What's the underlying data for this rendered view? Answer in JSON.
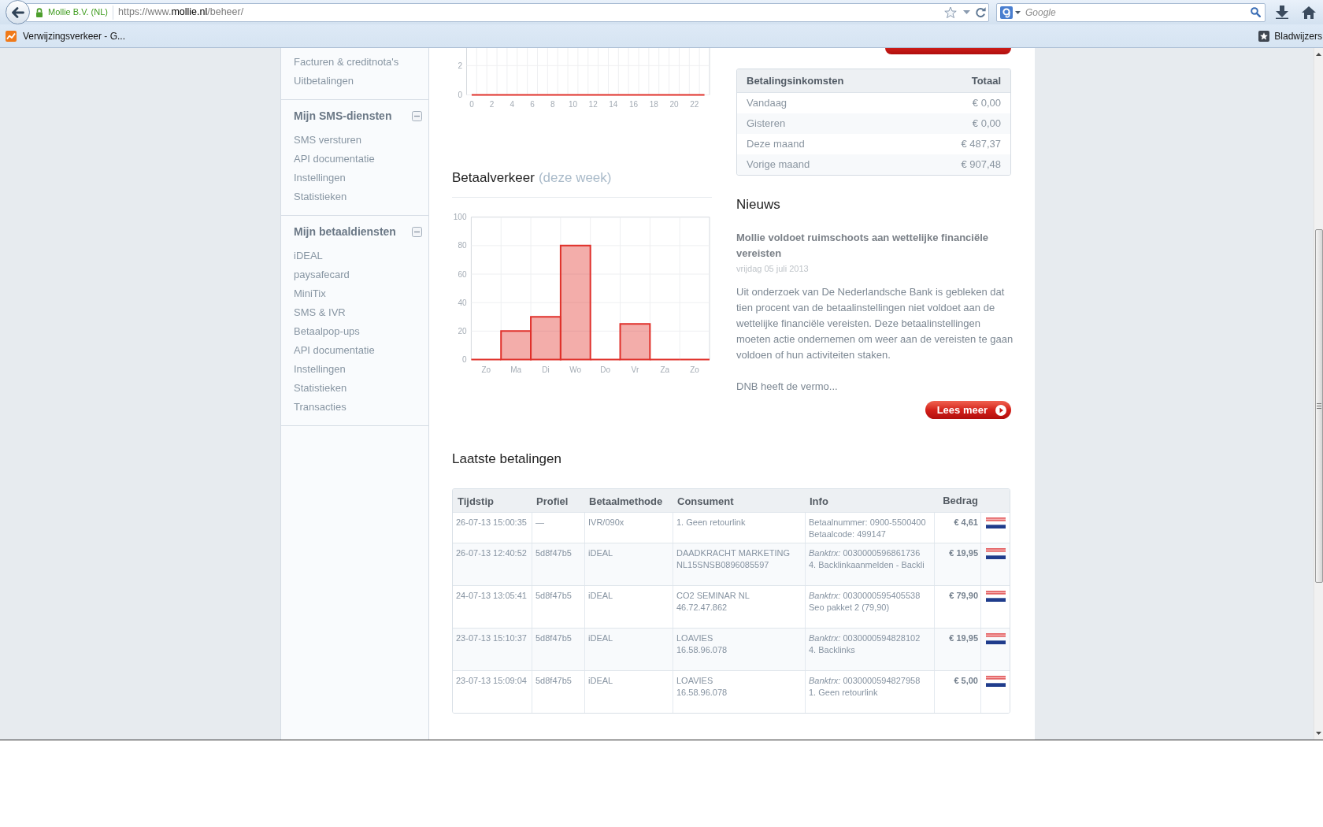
{
  "browser": {
    "site_identity": "Mollie B.V. (NL)",
    "url_parts": [
      {
        "text": "https://www.",
        "emphasis": false
      },
      {
        "text": "mollie.nl",
        "emphasis": true
      },
      {
        "text": "/beheer/",
        "emphasis": false
      }
    ],
    "search": {
      "placeholder": "Google"
    }
  },
  "bookmarks_bar": {
    "bookmarks": [
      {
        "label": "Verwijzingsverkeer - G..."
      }
    ],
    "menu_label": "Bladwijzers"
  },
  "sidebar": {
    "sections": [
      {
        "items": [
          {
            "label": "Facturen & creditnota's"
          },
          {
            "label": "Uitbetalingen"
          }
        ]
      },
      {
        "title": "Mijn SMS-diensten",
        "expanded": true,
        "items": [
          {
            "label": "SMS versturen"
          },
          {
            "label": "API documentatie"
          },
          {
            "label": "Instellingen"
          },
          {
            "label": "Statistieken"
          }
        ]
      },
      {
        "title": "Mijn betaaldiensten",
        "expanded": true,
        "items": [
          {
            "label": "iDEAL"
          },
          {
            "label": "paysafecard"
          },
          {
            "label": "MiniTix"
          },
          {
            "label": "SMS & IVR"
          },
          {
            "label": "Betaalpop-ups"
          },
          {
            "label": "API documentatie"
          },
          {
            "label": "Instellingen"
          },
          {
            "label": "Statistieken"
          },
          {
            "label": "Transacties"
          }
        ]
      }
    ]
  },
  "hourly_chart": {
    "chart_data": {
      "type": "line",
      "x": [
        0,
        1,
        2,
        3,
        4,
        5,
        6,
        7,
        8,
        9,
        10,
        11,
        12,
        13,
        14,
        15,
        16,
        17,
        18,
        19,
        20,
        21,
        22,
        23
      ],
      "xlim": [
        -0.5,
        23.5
      ],
      "ylim": [
        0,
        3.2
      ],
      "xticks": [
        0,
        2,
        4,
        6,
        8,
        10,
        12,
        14,
        16,
        18,
        20,
        22
      ],
      "yticks": [
        0,
        2
      ],
      "grid": true,
      "series": [
        {
          "color": "#e0312b",
          "values": [
            0,
            0,
            0,
            0,
            0,
            0,
            0,
            0,
            0,
            0,
            0,
            0,
            0,
            0,
            0,
            0,
            0,
            0,
            0,
            0,
            0,
            0,
            0,
            0
          ]
        }
      ]
    }
  },
  "weekly_chart": {
    "heading": "Betaalverkeer",
    "subheading": "(deze week)",
    "chart_data": {
      "type": "bar",
      "categories": [
        "Zo",
        "Ma",
        "Di",
        "Wo",
        "Do",
        "Vr",
        "Za",
        "Zo"
      ],
      "ylim": [
        0,
        100
      ],
      "yticks": [
        0,
        20,
        40,
        60,
        80,
        100
      ],
      "grid": true,
      "series": [
        {
          "color": "#e0312b",
          "values": [
            0,
            20,
            30,
            80,
            0,
            25,
            0,
            0
          ]
        }
      ]
    }
  },
  "income_table": {
    "columns": [
      "Betalingsinkomsten",
      "Totaal"
    ],
    "rows": [
      {
        "period": "Vandaag",
        "total": "€ 0,00"
      },
      {
        "period": "Gisteren",
        "total": "€ 0,00"
      },
      {
        "period": "Deze maand",
        "total": "€ 487,37"
      },
      {
        "period": "Vorige maand",
        "total": "€ 907,48"
      }
    ]
  },
  "news": {
    "heading": "Nieuws",
    "title": "Mollie voldoet ruimschoots aan wettelijke financiële vereisten",
    "date": "vrijdag 05 juli 2013",
    "paragraphs": [
      "Uit onderzoek van De Nederlandsche Bank is gebleken dat tien procent van de betaalinstellingen niet voldoet aan de wettelijke financiële vereisten. Deze betaalinstellingen moeten actie ondernemen om weer aan de vereisten te gaan voldoen of hun activiteiten staken.",
      "DNB heeft de vermo..."
    ],
    "button": "Lees meer"
  },
  "payments": {
    "heading": "Laatste betalingen",
    "columns": [
      "Tijdstip",
      "Profiel",
      "Betaalmethode",
      "Consument",
      "Info",
      "Bedrag"
    ],
    "rows": [
      {
        "kind": "phone",
        "time": "26-07-13 15:00:35",
        "profile": "—",
        "method": "IVR/090x",
        "consumer": [
          "1. Geen retourlink"
        ],
        "info": [
          "Betaalnummer: 0900-5500400",
          "Betaalcode: 499147"
        ],
        "amount": "€ 4,61"
      },
      {
        "kind": "bank",
        "time": "26-07-13 12:40:52",
        "profile": "5d8f47b5",
        "method": "iDEAL",
        "consumer": [
          "DAADKRACHT MARKETING",
          "NL15SNSB0896085597"
        ],
        "info": [
          "*Banktrx:* 0030000596861736",
          "4. Backlinkaanmelden - Backli"
        ],
        "amount": "€ 19,95"
      },
      {
        "kind": "bank",
        "time": "24-07-13 13:05:41",
        "profile": "5d8f47b5",
        "method": "iDEAL",
        "consumer": [
          "CO2 SEMINAR NL",
          "46.72.47.862"
        ],
        "info": [
          "*Banktrx:* 0030000595405538",
          "Seo pakket 2 (79,90)"
        ],
        "amount": "€ 79,90"
      },
      {
        "kind": "bank",
        "time": "23-07-13 15:10:37",
        "profile": "5d8f47b5",
        "method": "iDEAL",
        "consumer": [
          "LOAVIES",
          "16.58.96.078"
        ],
        "info": [
          "*Banktrx:* 0030000594828102",
          "4. Backlinks"
        ],
        "amount": "€ 19,95"
      },
      {
        "kind": "bank",
        "time": "23-07-13 15:09:04",
        "profile": "5d8f47b5",
        "method": "iDEAL",
        "consumer": [
          "LOAVIES",
          "16.58.96.078"
        ],
        "info": [
          "*Banktrx:* 0030000594827958",
          "1. Geen retourlink"
        ],
        "amount": "€ 5,00"
      }
    ]
  }
}
